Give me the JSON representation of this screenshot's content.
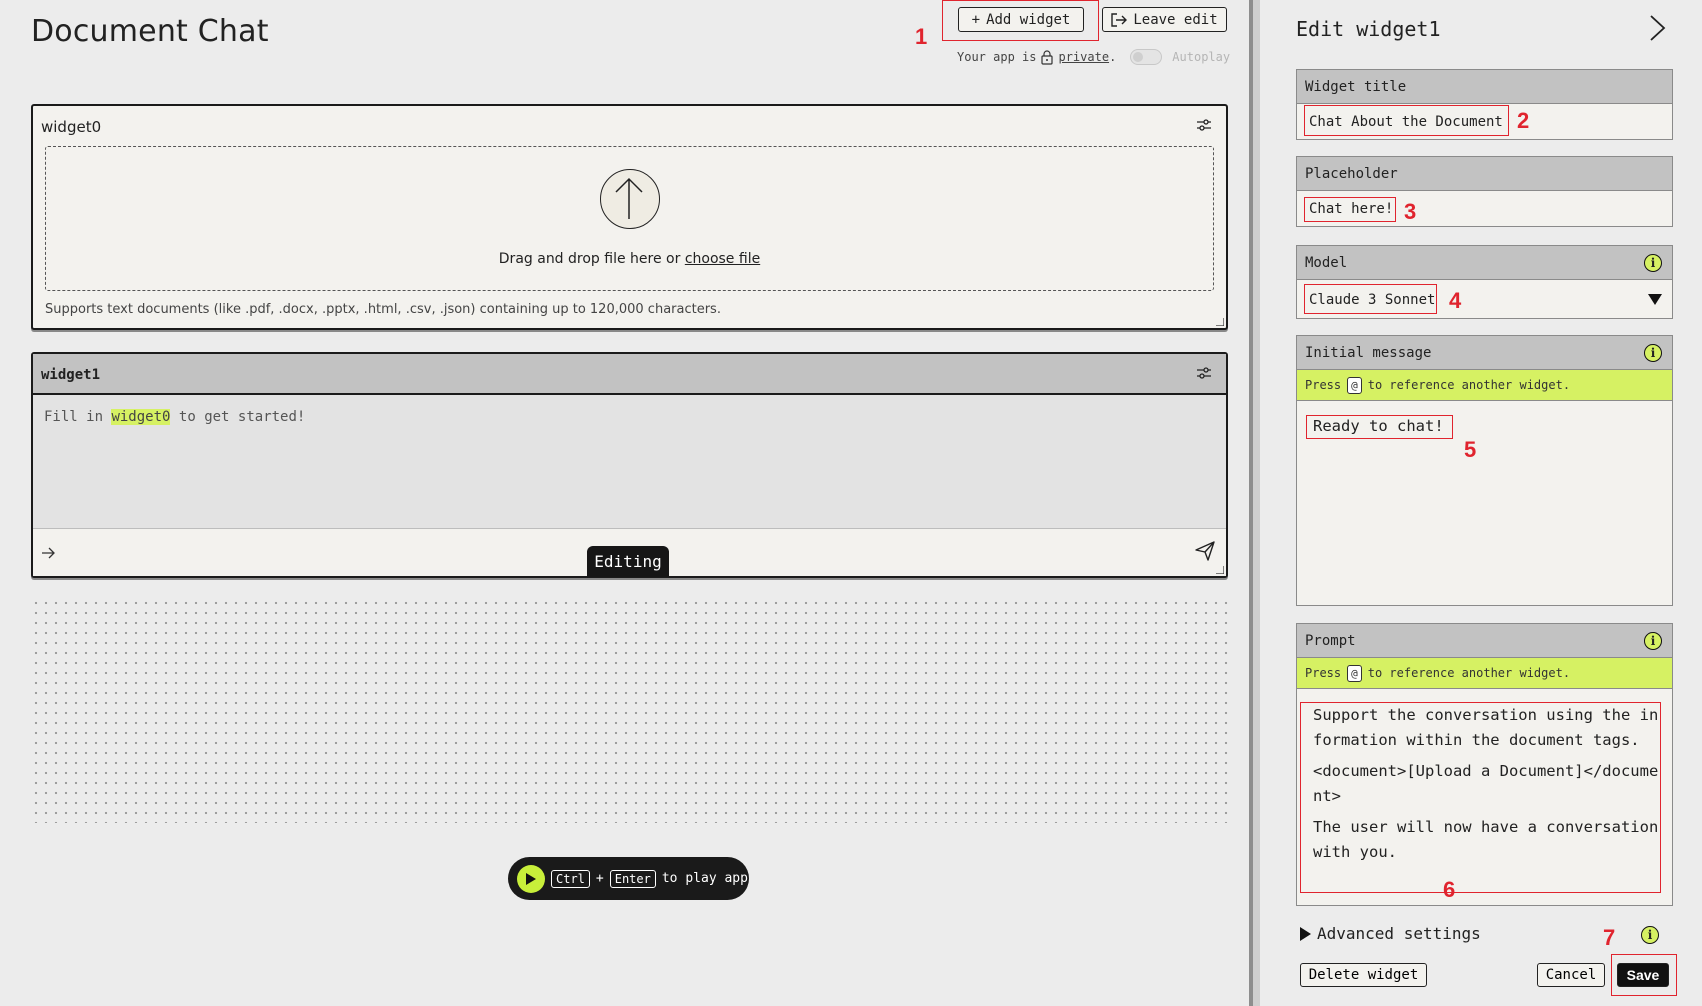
{
  "page": {
    "title": "Document Chat"
  },
  "toolbar": {
    "add_widget_label": "Add widget",
    "leave_edit_label": "Leave edit",
    "privacy_prefix": "Your app is",
    "privacy_value": "private",
    "privacy_suffix": ".",
    "autoplay_label": "Autoplay"
  },
  "annotations": [
    "1",
    "2",
    "3",
    "4",
    "5",
    "6",
    "7"
  ],
  "widget0": {
    "title": "widget0",
    "drop_text": "Drag and drop file here or",
    "choose_file": "choose file",
    "support_text": "Supports text documents (like .pdf, .docx, .pptx, .html, .csv, .json) containing up to 120,000 characters."
  },
  "widget1": {
    "title": "widget1",
    "body_prefix": "Fill in",
    "body_ref": "widget0",
    "body_suffix": "to get started!",
    "editing_badge": "Editing"
  },
  "play_bar": {
    "key1": "Ctrl",
    "plus": "+",
    "key2": "Enter",
    "label": "to play app"
  },
  "edit_panel": {
    "title": "Edit widget1",
    "widget_title_label": "Widget title",
    "widget_title_value": "Chat About the Document",
    "placeholder_label": "Placeholder",
    "placeholder_value": "Chat here!",
    "model_label": "Model",
    "model_value": "Claude 3 Sonnet",
    "initial_message_label": "Initial message",
    "hint_press": "Press",
    "hint_key": "@",
    "hint_rest": "to reference another widget.",
    "initial_message_value": "Ready to chat!",
    "prompt_label": "Prompt",
    "prompt_lines": [
      "Support the conversation using the information within the document tags.",
      "<document>[Upload a Document]</document>",
      "The user will now have a conversation with you."
    ],
    "advanced_settings_label": "Advanced settings",
    "delete_label": "Delete widget",
    "cancel_label": "Cancel",
    "save_label": "Save"
  },
  "colors": {
    "accent": "#d6f163",
    "annotation": "#e0242e",
    "dark": "#1a1a1a"
  }
}
